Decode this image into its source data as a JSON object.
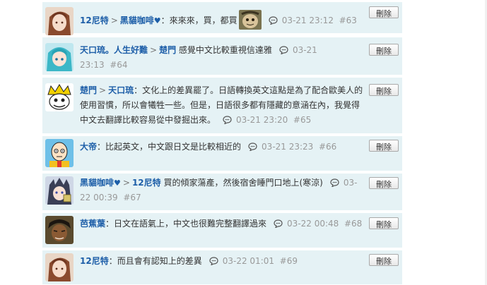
{
  "comments": [
    {
      "from": "12尼特",
      "to": "黑貓咖啡",
      "to_heart": "♥",
      "arrow": ">",
      "separator": "：",
      "text": "來來來，買，都買",
      "time": "03-21 23:12",
      "floor": "#63",
      "delete_label": "刪除"
    },
    {
      "from": "天口琉。人生好難",
      "to": "楚門",
      "arrow": ">",
      "separator": " ",
      "text": "感覺中文比較重視信達雅",
      "time_a": "03-21",
      "time_b": "23:13",
      "floor": "#64",
      "delete_label": "刪除"
    },
    {
      "from": "楚門",
      "to": "天口琉",
      "arrow": ">",
      "separator": "：",
      "text": "文化上的差異罷了。日語轉換英文這點是為了配合歐美人的使用習慣，所以會犧牲一些。但是，日語很多都有隱藏的意涵在內，我覺得中文去翻譯比較容易從中發掘出來。",
      "time": "03-21 23:20",
      "floor": "#65",
      "delete_label": "刪除"
    },
    {
      "from": "大帝",
      "separator": "：",
      "text": "比起英文，中文跟日文是比較相近的",
      "time": "03-21 23:23",
      "floor": "#66",
      "delete_label": "刪除"
    },
    {
      "from": "黑貓咖啡",
      "from_heart": "♥",
      "to": "12尼特",
      "arrow": ">",
      "separator": " ",
      "text": "買的傾家蕩產，然後宿舍睡門口地上(寒涼)",
      "time_a": "03-",
      "time_b": "22 00:39",
      "floor": "#67",
      "delete_label": "刪除"
    },
    {
      "from": "芭蕉葉",
      "separator": "：",
      "text": "日文在語氣上，中文也很難完整翻譯過來",
      "time": "03-22 00:48",
      "floor": "#68",
      "delete_label": "刪除"
    },
    {
      "from": "12尼特",
      "separator": "：",
      "text": "而且會有認知上的差異",
      "time": "03-22 01:01",
      "floor": "#69",
      "delete_label": "刪除"
    }
  ],
  "colors": {
    "row_bg": "#e5f2f5",
    "username": "#1d5ea8",
    "meta": "#999999"
  },
  "icons": {
    "reply": "speech-bubble-icon",
    "sticker": "sticker-image"
  }
}
